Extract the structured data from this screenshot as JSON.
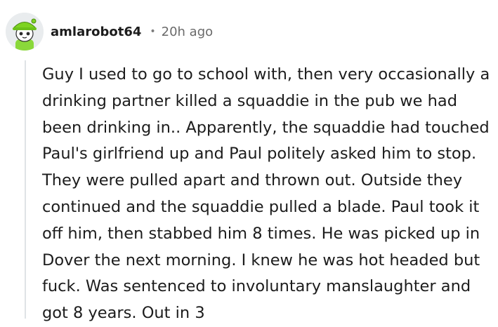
{
  "comment": {
    "author": "amlarobot64",
    "separator": "•",
    "timestamp": "20h ago",
    "avatar_icon": "robot-avatar-icon",
    "body": "Guy I used to go to school with, then very occasionally a drinking partner killed a squaddie in the pub we had been drinking in.. Apparently, the squaddie had touched Paul's girlfriend up and Paul politely asked him to stop. They were pulled apart and thrown out. Outside they continued and the squaddie pulled a blade. Paul took it off him, then stabbed him 8 times. He was picked up in Dover the next morning. I knew he was hot headed but fuck. Was sentenced to involuntary manslaughter and got 8 years. Out in 3"
  },
  "colors": {
    "avatar_background": "#e9ecee",
    "avatar_hat": "#7ed321",
    "thread_line": "#dfe3e6",
    "text": "#1c1c1c",
    "meta_text": "#6a6a6a"
  }
}
